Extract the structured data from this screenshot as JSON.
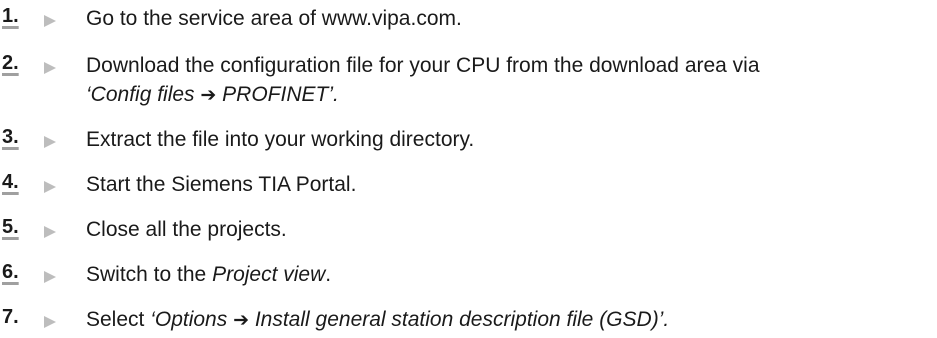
{
  "steps": [
    {
      "number": "1.",
      "segments": [
        {
          "text": "Go to the service area of www.vipa.com.",
          "italic": false
        }
      ]
    },
    {
      "number": "2.",
      "segments": [
        {
          "text": "Download the configuration file for your CPU from the download area via",
          "italic": false
        },
        {
          "text": "\n",
          "italic": false
        },
        {
          "text": "‘Config files ",
          "italic": true
        },
        {
          "text": "➔",
          "italic": true,
          "arrow": true
        },
        {
          "text": " PROFINET’.",
          "italic": true
        }
      ]
    },
    {
      "number": "3.",
      "segments": [
        {
          "text": "Extract the file into your working directory.",
          "italic": false
        }
      ]
    },
    {
      "number": "4.",
      "segments": [
        {
          "text": "Start the Siemens TIA Portal.",
          "italic": false
        }
      ]
    },
    {
      "number": "5.",
      "segments": [
        {
          "text": "Close all the projects.",
          "italic": false
        }
      ]
    },
    {
      "number": "6.",
      "segments": [
        {
          "text": "Switch to the ",
          "italic": false
        },
        {
          "text": "Project view",
          "italic": true
        },
        {
          "text": ".",
          "italic": false
        }
      ]
    },
    {
      "number": "7.",
      "segments": [
        {
          "text": "Select ",
          "italic": false
        },
        {
          "text": "‘Options ",
          "italic": true
        },
        {
          "text": "➔",
          "italic": true,
          "arrow": true
        },
        {
          "text": " Install general station description file (GSD)’.",
          "italic": true
        }
      ]
    }
  ]
}
